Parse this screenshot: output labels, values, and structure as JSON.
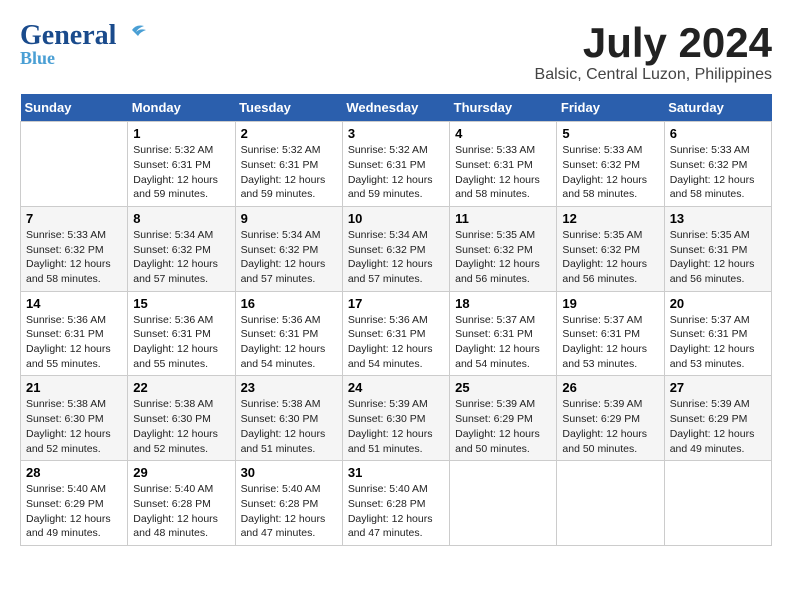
{
  "header": {
    "logo_line1": "General",
    "logo_line2": "Blue",
    "month_year": "July 2024",
    "location": "Balsic, Central Luzon, Philippines"
  },
  "calendar": {
    "days_of_week": [
      "Sunday",
      "Monday",
      "Tuesday",
      "Wednesday",
      "Thursday",
      "Friday",
      "Saturday"
    ],
    "weeks": [
      [
        {
          "day": "",
          "info": ""
        },
        {
          "day": "1",
          "info": "Sunrise: 5:32 AM\nSunset: 6:31 PM\nDaylight: 12 hours\nand 59 minutes."
        },
        {
          "day": "2",
          "info": "Sunrise: 5:32 AM\nSunset: 6:31 PM\nDaylight: 12 hours\nand 59 minutes."
        },
        {
          "day": "3",
          "info": "Sunrise: 5:32 AM\nSunset: 6:31 PM\nDaylight: 12 hours\nand 59 minutes."
        },
        {
          "day": "4",
          "info": "Sunrise: 5:33 AM\nSunset: 6:31 PM\nDaylight: 12 hours\nand 58 minutes."
        },
        {
          "day": "5",
          "info": "Sunrise: 5:33 AM\nSunset: 6:32 PM\nDaylight: 12 hours\nand 58 minutes."
        },
        {
          "day": "6",
          "info": "Sunrise: 5:33 AM\nSunset: 6:32 PM\nDaylight: 12 hours\nand 58 minutes."
        }
      ],
      [
        {
          "day": "7",
          "info": "Sunrise: 5:33 AM\nSunset: 6:32 PM\nDaylight: 12 hours\nand 58 minutes."
        },
        {
          "day": "8",
          "info": "Sunrise: 5:34 AM\nSunset: 6:32 PM\nDaylight: 12 hours\nand 57 minutes."
        },
        {
          "day": "9",
          "info": "Sunrise: 5:34 AM\nSunset: 6:32 PM\nDaylight: 12 hours\nand 57 minutes."
        },
        {
          "day": "10",
          "info": "Sunrise: 5:34 AM\nSunset: 6:32 PM\nDaylight: 12 hours\nand 57 minutes."
        },
        {
          "day": "11",
          "info": "Sunrise: 5:35 AM\nSunset: 6:32 PM\nDaylight: 12 hours\nand 56 minutes."
        },
        {
          "day": "12",
          "info": "Sunrise: 5:35 AM\nSunset: 6:32 PM\nDaylight: 12 hours\nand 56 minutes."
        },
        {
          "day": "13",
          "info": "Sunrise: 5:35 AM\nSunset: 6:31 PM\nDaylight: 12 hours\nand 56 minutes."
        }
      ],
      [
        {
          "day": "14",
          "info": "Sunrise: 5:36 AM\nSunset: 6:31 PM\nDaylight: 12 hours\nand 55 minutes."
        },
        {
          "day": "15",
          "info": "Sunrise: 5:36 AM\nSunset: 6:31 PM\nDaylight: 12 hours\nand 55 minutes."
        },
        {
          "day": "16",
          "info": "Sunrise: 5:36 AM\nSunset: 6:31 PM\nDaylight: 12 hours\nand 54 minutes."
        },
        {
          "day": "17",
          "info": "Sunrise: 5:36 AM\nSunset: 6:31 PM\nDaylight: 12 hours\nand 54 minutes."
        },
        {
          "day": "18",
          "info": "Sunrise: 5:37 AM\nSunset: 6:31 PM\nDaylight: 12 hours\nand 54 minutes."
        },
        {
          "day": "19",
          "info": "Sunrise: 5:37 AM\nSunset: 6:31 PM\nDaylight: 12 hours\nand 53 minutes."
        },
        {
          "day": "20",
          "info": "Sunrise: 5:37 AM\nSunset: 6:31 PM\nDaylight: 12 hours\nand 53 minutes."
        }
      ],
      [
        {
          "day": "21",
          "info": "Sunrise: 5:38 AM\nSunset: 6:30 PM\nDaylight: 12 hours\nand 52 minutes."
        },
        {
          "day": "22",
          "info": "Sunrise: 5:38 AM\nSunset: 6:30 PM\nDaylight: 12 hours\nand 52 minutes."
        },
        {
          "day": "23",
          "info": "Sunrise: 5:38 AM\nSunset: 6:30 PM\nDaylight: 12 hours\nand 51 minutes."
        },
        {
          "day": "24",
          "info": "Sunrise: 5:39 AM\nSunset: 6:30 PM\nDaylight: 12 hours\nand 51 minutes."
        },
        {
          "day": "25",
          "info": "Sunrise: 5:39 AM\nSunset: 6:29 PM\nDaylight: 12 hours\nand 50 minutes."
        },
        {
          "day": "26",
          "info": "Sunrise: 5:39 AM\nSunset: 6:29 PM\nDaylight: 12 hours\nand 50 minutes."
        },
        {
          "day": "27",
          "info": "Sunrise: 5:39 AM\nSunset: 6:29 PM\nDaylight: 12 hours\nand 49 minutes."
        }
      ],
      [
        {
          "day": "28",
          "info": "Sunrise: 5:40 AM\nSunset: 6:29 PM\nDaylight: 12 hours\nand 49 minutes."
        },
        {
          "day": "29",
          "info": "Sunrise: 5:40 AM\nSunset: 6:28 PM\nDaylight: 12 hours\nand 48 minutes."
        },
        {
          "day": "30",
          "info": "Sunrise: 5:40 AM\nSunset: 6:28 PM\nDaylight: 12 hours\nand 47 minutes."
        },
        {
          "day": "31",
          "info": "Sunrise: 5:40 AM\nSunset: 6:28 PM\nDaylight: 12 hours\nand 47 minutes."
        },
        {
          "day": "",
          "info": ""
        },
        {
          "day": "",
          "info": ""
        },
        {
          "day": "",
          "info": ""
        }
      ]
    ]
  }
}
